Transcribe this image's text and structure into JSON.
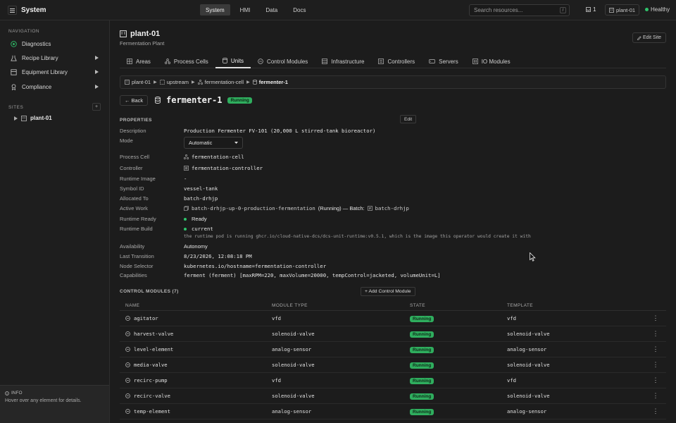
{
  "topbar": {
    "app_title": "System",
    "tabs": [
      "System",
      "HMI",
      "Data",
      "Docs"
    ],
    "search_placeholder": "Search resources...",
    "search_shortcut": "/",
    "notif_count": "1",
    "site_chip": "plant-01",
    "health": "Healthy",
    "colors": {
      "healthy": "#2fc36b"
    }
  },
  "sidebar": {
    "nav_label": "NAVIGATION",
    "items": [
      {
        "label": "Diagnostics",
        "icon": "target-icon"
      },
      {
        "label": "Recipe Library",
        "icon": "flask-icon"
      },
      {
        "label": "Equipment Library",
        "icon": "box-icon"
      },
      {
        "label": "Compliance",
        "icon": "ribbon-icon"
      }
    ],
    "sites_label": "SITES",
    "sites": [
      "plant-01"
    ],
    "info_title": "INFO",
    "info_text": "Hover over any element for details."
  },
  "site": {
    "title": "plant-01",
    "subtitle": "Fermentation Plant",
    "edit_label": "Edit Site"
  },
  "tabs": [
    "Areas",
    "Process Cells",
    "Units",
    "Control Modules",
    "Infrastructure",
    "Controllers",
    "Servers",
    "IO Modules"
  ],
  "breadcrumb": [
    "plant-01",
    "upstream",
    "fermentation-cell",
    "fermenter-1"
  ],
  "unit": {
    "back_label": "Back",
    "name": "fermenter-1",
    "status": "Running"
  },
  "properties": {
    "heading": "PROPERTIES",
    "edit_label": "Edit",
    "description_k": "Description",
    "description_v": "Production Fermenter FV-101 (20,000 L stirred-tank bioreactor)",
    "mode_k": "Mode",
    "mode_v": "Automatic",
    "process_cell_k": "Process Cell",
    "process_cell_v": "fermentation-cell",
    "controller_k": "Controller",
    "controller_v": "fermentation-controller",
    "runtime_image_k": "Runtime Image",
    "runtime_image_v": "-",
    "symbol_id_k": "Symbol ID",
    "symbol_id_v": "vessel-tank",
    "allocated_k": "Allocated To",
    "allocated_v": "batch-drhjp",
    "active_work_k": "Active Work",
    "active_work_v": "batch-drhjp-up-0-production-fermentation",
    "active_work_status": "(Running) — Batch:",
    "active_work_batch": "batch-drhjp",
    "runtime_ready_k": "Runtime Ready",
    "runtime_ready_v": "Ready",
    "runtime_build_k": "Runtime Build",
    "runtime_build_v": "current",
    "runtime_hint": "the runtime pod is running ghcr.io/cloud-native-dcs/dcs-unit-runtime:v0.5.1, which is the image this operator would create it with",
    "availability_k": "Availability",
    "availability_v": "Autonomy",
    "last_transition_k": "Last Transition",
    "last_transition_v": "8/23/2026, 12:08:18 PM",
    "node_selector_k": "Node Selector",
    "node_selector_v": "kubernetes.io/hostname=fermentation-controller",
    "capabilities_k": "Capabilities",
    "capabilities_v": "ferment (ferment) [maxRPM=220, maxVolume=20000, tempControl=jacketed, volumeUnit=L]"
  },
  "control_modules": {
    "heading": "CONTROL MODULES (7)",
    "add_label": "+ Add Control Module",
    "columns": [
      "NAME",
      "MODULE TYPE",
      "STATE",
      "TEMPLATE"
    ],
    "rows": [
      {
        "name": "agitator",
        "type": "vfd",
        "state": "Running",
        "template": "vfd"
      },
      {
        "name": "harvest-valve",
        "type": "solenoid-valve",
        "state": "Running",
        "template": "solenoid-valve"
      },
      {
        "name": "level-element",
        "type": "analog-sensor",
        "state": "Running",
        "template": "analog-sensor"
      },
      {
        "name": "media-valve",
        "type": "solenoid-valve",
        "state": "Running",
        "template": "solenoid-valve"
      },
      {
        "name": "recirc-pump",
        "type": "vfd",
        "state": "Running",
        "template": "vfd"
      },
      {
        "name": "recirc-valve",
        "type": "solenoid-valve",
        "state": "Running",
        "template": "solenoid-valve"
      },
      {
        "name": "temp-element",
        "type": "analog-sensor",
        "state": "Running",
        "template": "analog-sensor"
      }
    ]
  }
}
